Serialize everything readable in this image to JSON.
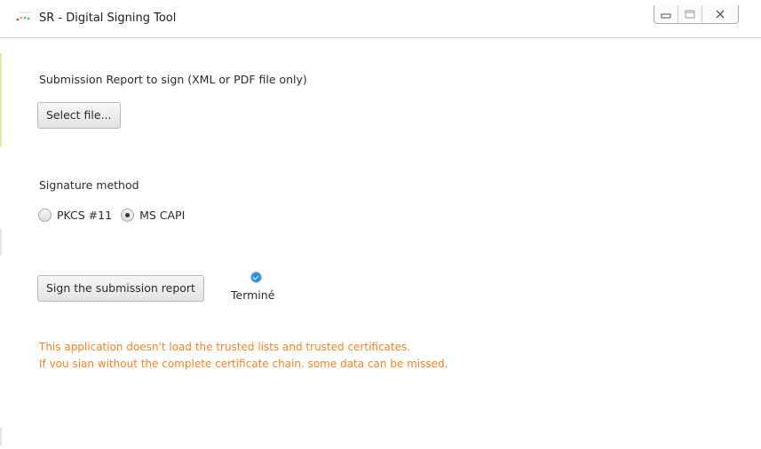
{
  "window": {
    "title": "SR - Digital Signing Tool",
    "controls": {
      "minimize_icon": "minimize-icon",
      "maximize_icon": "maximize-icon",
      "close_icon": "close-icon"
    }
  },
  "file_section": {
    "label": "Submission Report to sign (XML or PDF file only)",
    "select_button": "Select file..."
  },
  "signature_section": {
    "label": "Signature method",
    "options": [
      {
        "label": "PKCS #11",
        "selected": false
      },
      {
        "label": "MS CAPI",
        "selected": true
      }
    ]
  },
  "sign_section": {
    "sign_button": "Sign the submission report",
    "status_icon": "checkmark-icon",
    "status_text": "Terminé"
  },
  "warning": {
    "line1": "This application doesn't load the trusted lists and trusted certificates.",
    "line2": "If vou sian without the complete certificate chain. some data can be missed."
  },
  "colors": {
    "warning": "#f0842a",
    "status_icon": "#2f8fd7"
  }
}
